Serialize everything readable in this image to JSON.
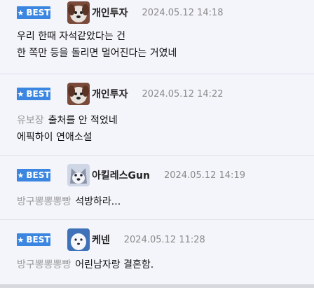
{
  "comments": [
    {
      "badge": "BEST",
      "nickname": "개인투자",
      "date": "2024.05.12 14:18",
      "mention": "",
      "lines": [
        "우리 한때 자석같았다는 건",
        "한 쪽만 등을 돌리면 멀어진다는 거였네"
      ],
      "avatar": "puppy-avatar"
    },
    {
      "badge": "BEST",
      "nickname": "개인투자",
      "date": "2024.05.12 14:22",
      "mention": "유보장",
      "lines": [
        "출처를 안 적었네",
        "에픽하이 연애소설"
      ],
      "avatar": "puppy-avatar"
    },
    {
      "badge": "BEST",
      "nickname": "아킬레스Gun",
      "date": "2024.05.12 14:19",
      "mention": "방구뽕뽕뽕빵",
      "lines": [
        "석방하라..."
      ],
      "avatar": "husky-avatar"
    },
    {
      "badge": "BEST",
      "nickname": "케넨",
      "date": "2024.05.12 11:28",
      "mention": "방구뽕뽕뽕빵",
      "lines": [
        "어린남자랑 결혼함."
      ],
      "avatar": "ghost-dog-avatar"
    }
  ],
  "colors": {
    "badge": "#3a86e0",
    "background": "#f4f5fb",
    "mention": "#9a9a9a",
    "date": "#8a8a8a"
  },
  "icons": {
    "badge_icon": "star-icon"
  }
}
